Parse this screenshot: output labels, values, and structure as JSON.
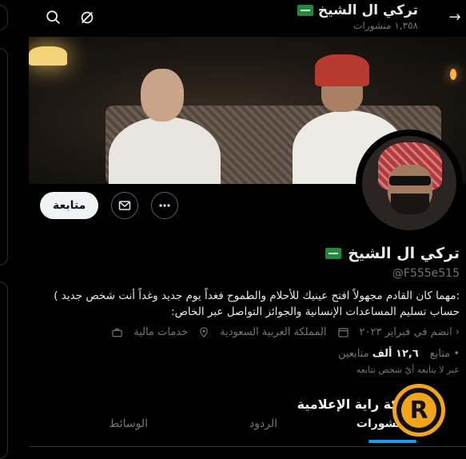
{
  "header": {
    "title": "تركي ال الشيخ",
    "posts_count": "١,٣٥٨ منشورات"
  },
  "actions": {
    "follow_label": "متابعة"
  },
  "profile": {
    "name": "تركي ال الشيخ",
    "handle": "@F555e515",
    "bio_line1": ":مهما كان القادم مجهولاً افتح عينيك للأحلام والطموح فغداً يوم جديد وغداً أنت شخص جديد )",
    "bio_line2": "حساب تسليم المساعدات الإنسانية والجوائز التواصل عبر الخاص:",
    "category": "خدمات مالية",
    "location": "المملكة العربية السعودية",
    "joined": "انضم في فبراير ٢٠٢٣",
    "following_label": "متابع",
    "followers_count": "١٢,٦ ألف",
    "followers_label": "متابعين",
    "followed_by": "عبر لا يتابعه أيّ شخص تتابعه"
  },
  "tabs": [
    {
      "label": "المنشورات"
    },
    {
      "label": "الردود"
    },
    {
      "label": "الوسائط"
    }
  ],
  "watermark": {
    "text": "شبكة راية الإعلامية",
    "logo_letter": "R"
  },
  "colors": {
    "accent": "#1d9bf0",
    "logo": "#f2a51a",
    "flag": "#1f8a3b"
  }
}
